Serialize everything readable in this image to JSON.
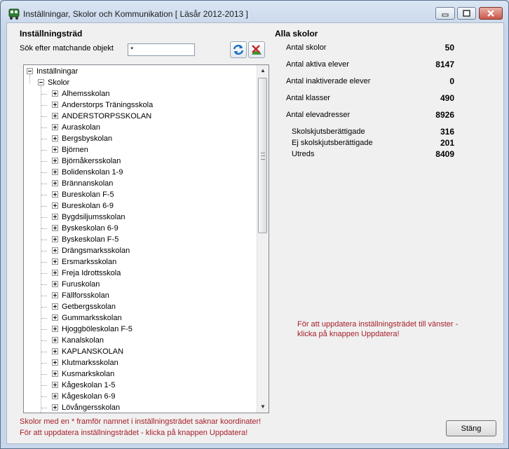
{
  "window": {
    "title": "Inställningar, Skolor och Kommunikation [ Läsår 2012-2013 ]"
  },
  "left": {
    "group_title": "Inställningsträd",
    "search_label": "Sök efter matchande objekt",
    "search_value": "*",
    "refresh_icon": "refresh-icon",
    "clear_icon": "clear-filter-icon"
  },
  "tree": {
    "root": "Inställningar",
    "child": "Skolor",
    "schools": [
      "Alhemsskolan",
      "Anderstorps Träningsskola",
      "ANDERSTORPSSKOLAN",
      "Auraskolan",
      "Bergsbyskolan",
      "Björnen",
      "Björnåkersskolan",
      "Bolidenskolan 1-9",
      "Brännanskolan",
      "Bureskolan  F-5",
      "Bureskolan 6-9",
      "Bygdsiljumsskolan",
      "Byskeskolan 6-9",
      "Byskeskolan F-5",
      "Drängsmarksskolan",
      "Ersmarksskolan",
      "Freja Idrottsskola",
      "Furuskolan",
      "Fällforsskolan",
      "Getbergsskolan",
      "Gummarksskolan",
      "Hjoggböleskolan F-5",
      "Kanalskolan",
      "KAPLANSKOLAN",
      "Klutmarksskolan",
      "Kusmarkskolan",
      "Kågeskolan 1-5",
      "Kågeskolan 6-9",
      "Lövångersskolan"
    ]
  },
  "right": {
    "group_title": "Alla skolor",
    "stats": [
      {
        "label": "Antal skolor",
        "value": "50"
      },
      {
        "label": "Antal aktiva elever",
        "value": "8147"
      },
      {
        "label": "Antal inaktiverade elever",
        "value": "0"
      },
      {
        "label": "Antal klasser",
        "value": "490"
      },
      {
        "label": "Antal elevadresser",
        "value": "8926"
      }
    ],
    "substats": [
      {
        "label": "Skolskjutsberättigade",
        "value": "316"
      },
      {
        "label": "Ej skolskjutsberättigade",
        "value": "201"
      },
      {
        "label": "Utreds",
        "value": "8409"
      }
    ],
    "note_line1": "För att uppdatera inställningsträdet till vänster -",
    "note_line2": "klicka på knappen Uppdatera!"
  },
  "footer": {
    "note1": "Skolor med en * framför namnet i inställningsträdet saknar koordinater!",
    "note2": "För att uppdatera inställningsträdet - klicka på knappen Uppdatera!",
    "close_label": "Stäng"
  }
}
